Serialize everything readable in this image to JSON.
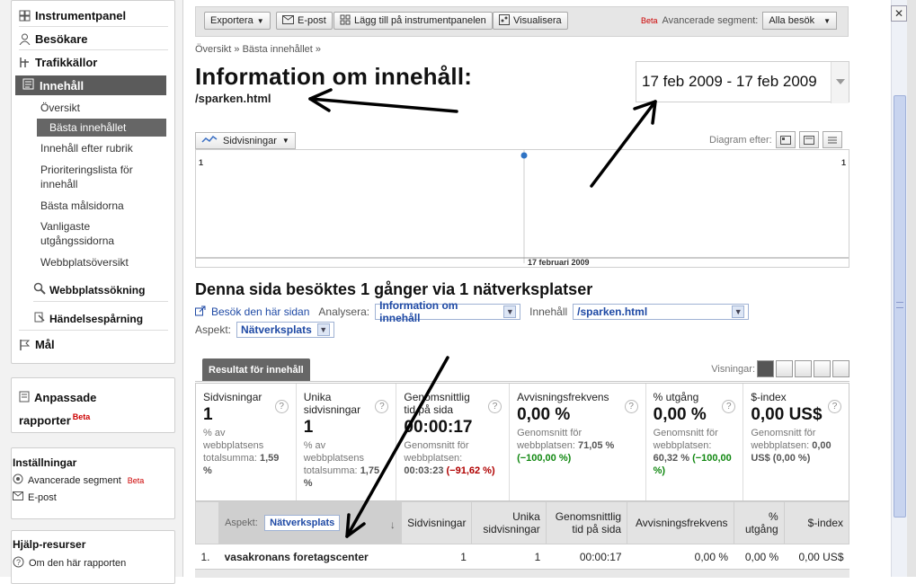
{
  "sidebar": {
    "items": [
      {
        "label": "Instrumentpanel",
        "icon": "dashboard-icon"
      },
      {
        "label": "Besökare",
        "icon": "person-icon"
      },
      {
        "label": "Trafikkällor",
        "icon": "traffic-icon"
      },
      {
        "label": "Innehåll",
        "icon": "content-icon"
      }
    ],
    "content_sub": [
      "Översikt",
      "Bästa innehållet",
      "Innehåll efter rubrik",
      "Prioriteringslista för innehåll",
      "Bästa målsidorna",
      "Vanligaste utgångssidorna",
      "Webbplatsöversikt"
    ],
    "site_search": "Webbplatssökning",
    "event_tracking": "Händelsespårning",
    "goals": "Mål",
    "custom_reports": "Anpassade rapporter",
    "beta": "Beta",
    "settings_title": "Inställningar",
    "settings_items": [
      "Avancerade segment",
      "E-post"
    ],
    "help_title": "Hjälp-resurser",
    "help_items": [
      "Om den här rapporten"
    ]
  },
  "toolbar": {
    "export": "Exportera",
    "email": "E-post",
    "add_dashboard": "Lägg till på instrumentpanelen",
    "visualize": "Visualisera",
    "beta": "Beta",
    "advanced_segments": "Avancerade segment:",
    "segment_value": "Alla besök"
  },
  "breadcrumb": "Översikt » Bästa innehållet »",
  "title": "Information om innehåll:",
  "subtitle": "/sparken.html",
  "date_range": "17 feb 2009 - 17 feb 2009",
  "chart_controls": {
    "metric": "Sidvisningar",
    "graph_by": "Diagram efter:"
  },
  "chart_data": {
    "type": "line",
    "x": [
      "17 februari 2009"
    ],
    "series": [
      {
        "values": [
          1
        ]
      }
    ],
    "y_left_label": "1",
    "y_right_label": "1",
    "x_label": "17 februari 2009"
  },
  "section": {
    "heading": "Denna sida besöktes 1 gånger via 1 nätverksplatser",
    "visit_link": "Besök den här sidan",
    "analyze_label": "Analysera:",
    "analyze_value": "Information om innehåll",
    "content_label": "Innehåll",
    "content_value": "/sparken.html",
    "aspect_label": "Aspekt:",
    "aspect_value": "Nätverksplats"
  },
  "results": {
    "tab": "Resultat för innehåll",
    "views_label": "Visningar:"
  },
  "stats": [
    {
      "label": "Sidvisningar",
      "value": "1",
      "note": "% av webbplatsens totalsumma:",
      "note_value": "1,59 %"
    },
    {
      "label": "Unika sidvisningar",
      "value": "1",
      "note": "% av webbplatsens totalsumma:",
      "note_value": "1,75 %"
    },
    {
      "label": "Genomsnittlig tid på sida",
      "value": "00:00:17",
      "note": "Genomsnitt för webbplatsen:",
      "note_value": "00:03:23",
      "delta": "(−91,62 %)"
    },
    {
      "label": "Avvisningsfrekvens",
      "value": "0,00 %",
      "note": "Genomsnitt för webbplatsen:",
      "note_value": "71,05 %",
      "delta": "(−100,00 %)"
    },
    {
      "label": "% utgång",
      "value": "0,00 %",
      "note": "Genomsnitt för webbplatsen:",
      "note_value": "60,32 %",
      "delta": "(−100,00 %)"
    },
    {
      "label": "$-index",
      "value": "0,00 US$",
      "note": "Genomsnitt för webbplatsen:",
      "note_value": "0,00 US$ (0,00 %)"
    }
  ],
  "table": {
    "aspect_label": "Aspekt:",
    "aspect_value": "Nätverksplats",
    "columns": [
      "Sidvisningar",
      "Unika sidvisningar",
      "Genomsnittlig tid på sida",
      "Avvisningsfrekvens",
      "% utgång",
      "$-index"
    ],
    "rows": [
      {
        "num": "1.",
        "name": "vasakronans foretagscenter",
        "values": [
          "1",
          "1",
          "00:00:17",
          "0,00 %",
          "0,00 %",
          "0,00 US$"
        ]
      }
    ]
  },
  "colors": {
    "active_nav": "#5b5b5b",
    "link": "#1f4aa5",
    "negative": "#b00000",
    "positive": "#118811",
    "beta": "#cc0000"
  }
}
